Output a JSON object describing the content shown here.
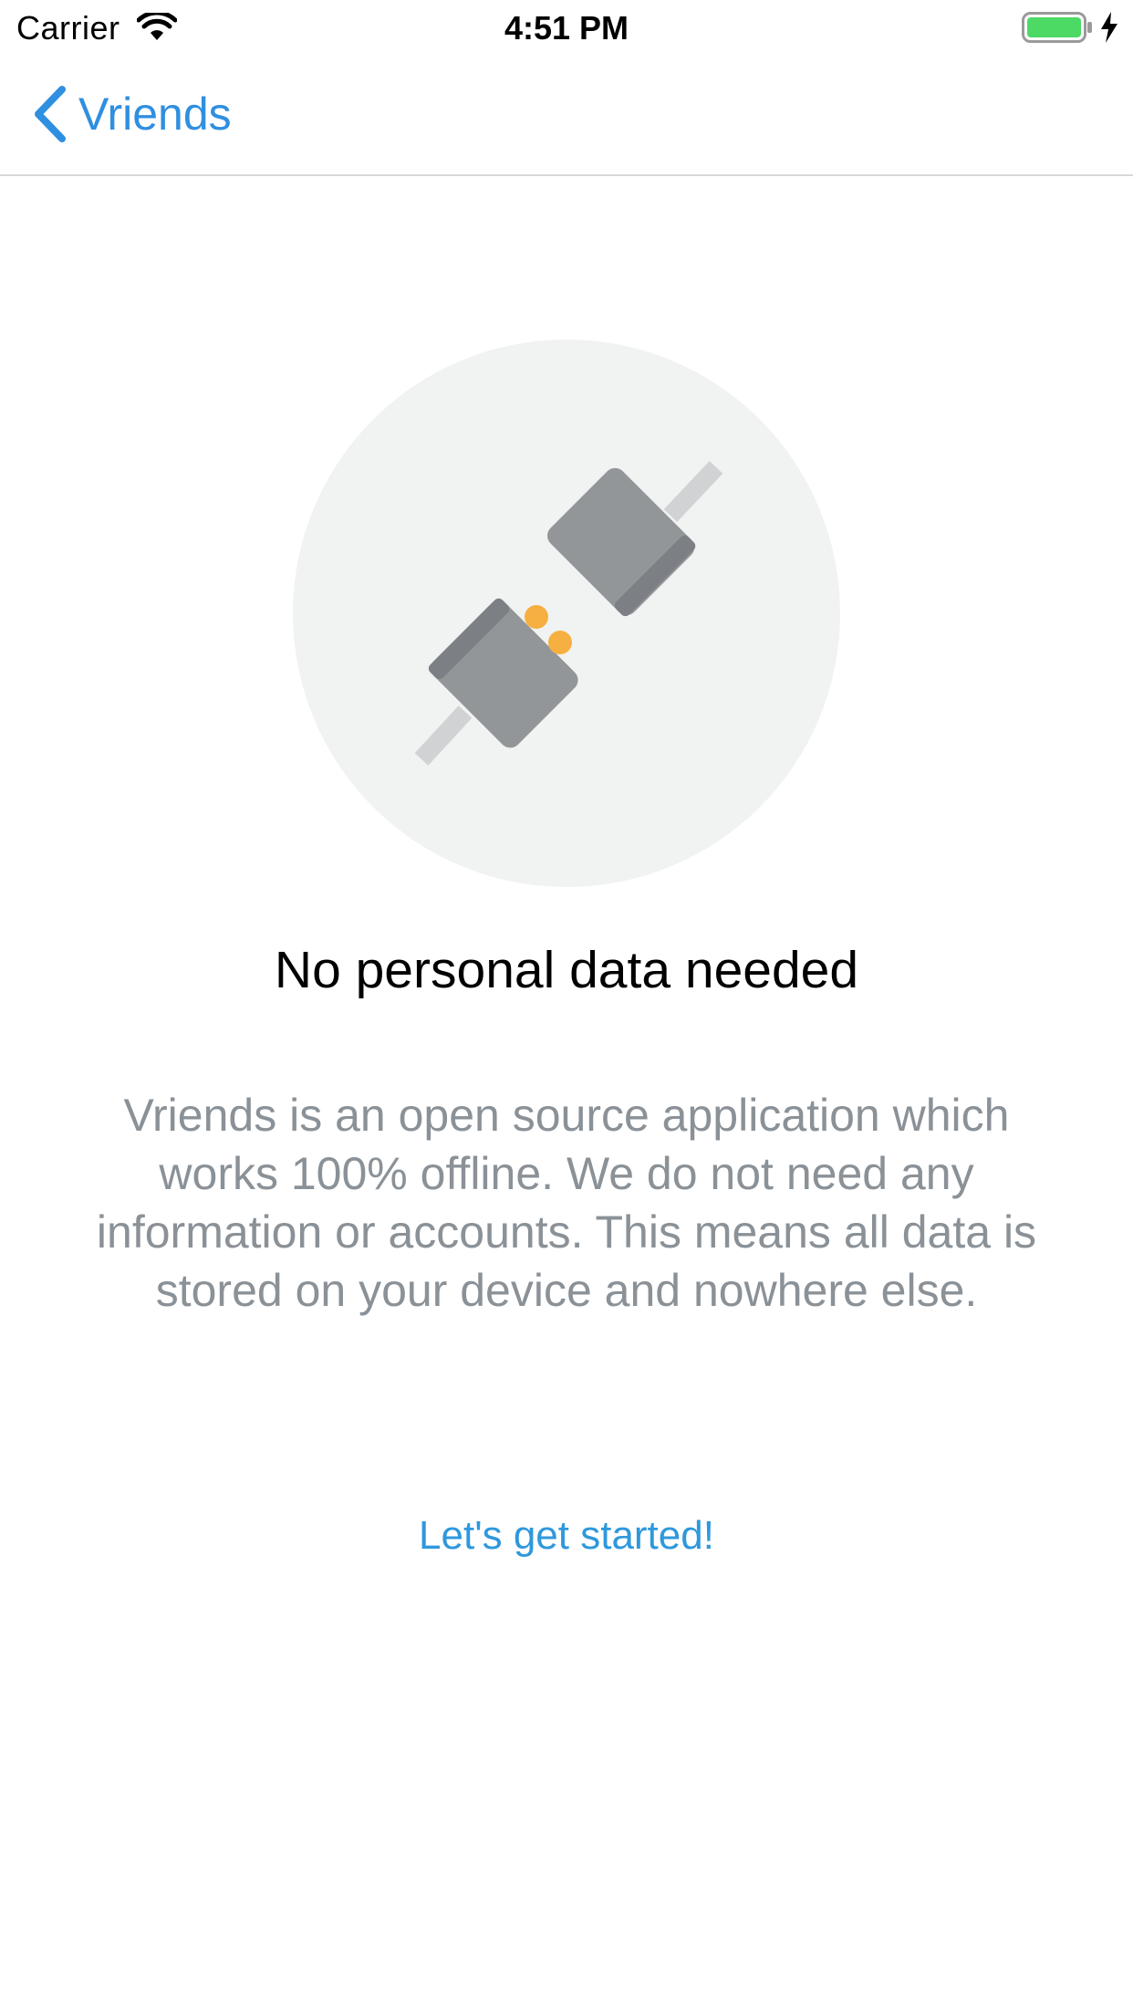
{
  "status_bar": {
    "carrier": "Carrier",
    "time": "4:51 PM",
    "icons": [
      "wifi-icon",
      "battery-icon",
      "charging-bolt-icon"
    ],
    "battery_color": "#4cd964"
  },
  "nav_bar": {
    "back_label": "Vriends",
    "back_icon": "chevron-left-icon",
    "accent_color": "#2f8fe0"
  },
  "onboarding": {
    "illustration": "plug-disconnected-icon",
    "title": "No personal data needed",
    "description": "Vriends is an open source application which works 100% offline. We do not need any information or accounts. This means all data is stored on your device and nowhere else.",
    "cta_label": "Let's get started!"
  }
}
